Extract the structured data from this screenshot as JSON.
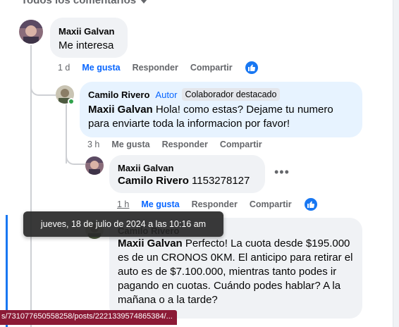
{
  "sort_label": "Todos los comentarios",
  "actions": {
    "like": "Me gusta",
    "reply": "Responder",
    "share": "Compartir"
  },
  "comments": [
    {
      "author": "Maxii Galvan",
      "text": "Me interesa",
      "time": "1 d",
      "liked": true
    },
    {
      "author": "Camilo Rivero",
      "author_tag": "Autor",
      "badge": "Colaborador destacado",
      "mention": "Maxii Galvan",
      "text": "Hola! como estas? Dejame tu numero para enviarte toda la informacion por favor!",
      "time": "3 h"
    },
    {
      "author": "Maxii Galvan",
      "mention": "Camilo Rivero",
      "text": "1153278127",
      "time": "1 h",
      "liked": true
    },
    {
      "author": "Camilo Rivero",
      "mention": "Maxii Galvan",
      "text": "Perfecto! La cuota desde $195.000 es de un CRONOS 0KM. El anticipo para retirar el auto es de $7.100.000, mientras tanto podes ir pagando en cuotas. Cuándo podes hablar? A la mañana o a la tarde?"
    }
  ],
  "tooltip": "jueves, 18 de julio de 2024 a las 10:16 am",
  "status_url": "s/731077650558258/posts/2221339574865384/...",
  "colors": {
    "accent": "#0866ff",
    "online": "#31a24c",
    "bubble_gray": "#f0f2f5",
    "bubble_highlight": "#e7f3ff"
  }
}
